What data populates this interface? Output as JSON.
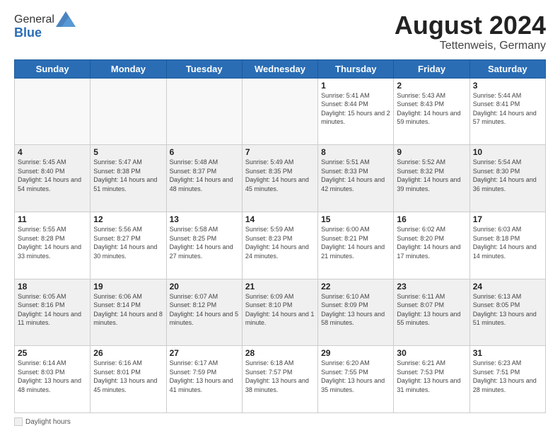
{
  "header": {
    "logo_general": "General",
    "logo_blue": "Blue",
    "month_year": "August 2024",
    "location": "Tettenweis, Germany"
  },
  "footer": {
    "label": "Daylight hours"
  },
  "days_of_week": [
    "Sunday",
    "Monday",
    "Tuesday",
    "Wednesday",
    "Thursday",
    "Friday",
    "Saturday"
  ],
  "weeks": [
    [
      {
        "day": "",
        "info": "",
        "empty": true
      },
      {
        "day": "",
        "info": "",
        "empty": true
      },
      {
        "day": "",
        "info": "",
        "empty": true
      },
      {
        "day": "",
        "info": "",
        "empty": true
      },
      {
        "day": "1",
        "info": "Sunrise: 5:41 AM\nSunset: 8:44 PM\nDaylight: 15 hours\nand 2 minutes.",
        "empty": false
      },
      {
        "day": "2",
        "info": "Sunrise: 5:43 AM\nSunset: 8:43 PM\nDaylight: 14 hours\nand 59 minutes.",
        "empty": false
      },
      {
        "day": "3",
        "info": "Sunrise: 5:44 AM\nSunset: 8:41 PM\nDaylight: 14 hours\nand 57 minutes.",
        "empty": false
      }
    ],
    [
      {
        "day": "4",
        "info": "Sunrise: 5:45 AM\nSunset: 8:40 PM\nDaylight: 14 hours\nand 54 minutes.",
        "shaded": true
      },
      {
        "day": "5",
        "info": "Sunrise: 5:47 AM\nSunset: 8:38 PM\nDaylight: 14 hours\nand 51 minutes.",
        "shaded": true
      },
      {
        "day": "6",
        "info": "Sunrise: 5:48 AM\nSunset: 8:37 PM\nDaylight: 14 hours\nand 48 minutes.",
        "shaded": true
      },
      {
        "day": "7",
        "info": "Sunrise: 5:49 AM\nSunset: 8:35 PM\nDaylight: 14 hours\nand 45 minutes.",
        "shaded": true
      },
      {
        "day": "8",
        "info": "Sunrise: 5:51 AM\nSunset: 8:33 PM\nDaylight: 14 hours\nand 42 minutes.",
        "shaded": true
      },
      {
        "day": "9",
        "info": "Sunrise: 5:52 AM\nSunset: 8:32 PM\nDaylight: 14 hours\nand 39 minutes.",
        "shaded": true
      },
      {
        "day": "10",
        "info": "Sunrise: 5:54 AM\nSunset: 8:30 PM\nDaylight: 14 hours\nand 36 minutes.",
        "shaded": true
      }
    ],
    [
      {
        "day": "11",
        "info": "Sunrise: 5:55 AM\nSunset: 8:28 PM\nDaylight: 14 hours\nand 33 minutes.",
        "empty": false
      },
      {
        "day": "12",
        "info": "Sunrise: 5:56 AM\nSunset: 8:27 PM\nDaylight: 14 hours\nand 30 minutes.",
        "empty": false
      },
      {
        "day": "13",
        "info": "Sunrise: 5:58 AM\nSunset: 8:25 PM\nDaylight: 14 hours\nand 27 minutes.",
        "empty": false
      },
      {
        "day": "14",
        "info": "Sunrise: 5:59 AM\nSunset: 8:23 PM\nDaylight: 14 hours\nand 24 minutes.",
        "empty": false
      },
      {
        "day": "15",
        "info": "Sunrise: 6:00 AM\nSunset: 8:21 PM\nDaylight: 14 hours\nand 21 minutes.",
        "empty": false
      },
      {
        "day": "16",
        "info": "Sunrise: 6:02 AM\nSunset: 8:20 PM\nDaylight: 14 hours\nand 17 minutes.",
        "empty": false
      },
      {
        "day": "17",
        "info": "Sunrise: 6:03 AM\nSunset: 8:18 PM\nDaylight: 14 hours\nand 14 minutes.",
        "empty": false
      }
    ],
    [
      {
        "day": "18",
        "info": "Sunrise: 6:05 AM\nSunset: 8:16 PM\nDaylight: 14 hours\nand 11 minutes.",
        "shaded": true
      },
      {
        "day": "19",
        "info": "Sunrise: 6:06 AM\nSunset: 8:14 PM\nDaylight: 14 hours\nand 8 minutes.",
        "shaded": true
      },
      {
        "day": "20",
        "info": "Sunrise: 6:07 AM\nSunset: 8:12 PM\nDaylight: 14 hours\nand 5 minutes.",
        "shaded": true
      },
      {
        "day": "21",
        "info": "Sunrise: 6:09 AM\nSunset: 8:10 PM\nDaylight: 14 hours\nand 1 minute.",
        "shaded": true
      },
      {
        "day": "22",
        "info": "Sunrise: 6:10 AM\nSunset: 8:09 PM\nDaylight: 13 hours\nand 58 minutes.",
        "shaded": true
      },
      {
        "day": "23",
        "info": "Sunrise: 6:11 AM\nSunset: 8:07 PM\nDaylight: 13 hours\nand 55 minutes.",
        "shaded": true
      },
      {
        "day": "24",
        "info": "Sunrise: 6:13 AM\nSunset: 8:05 PM\nDaylight: 13 hours\nand 51 minutes.",
        "shaded": true
      }
    ],
    [
      {
        "day": "25",
        "info": "Sunrise: 6:14 AM\nSunset: 8:03 PM\nDaylight: 13 hours\nand 48 minutes.",
        "empty": false
      },
      {
        "day": "26",
        "info": "Sunrise: 6:16 AM\nSunset: 8:01 PM\nDaylight: 13 hours\nand 45 minutes.",
        "empty": false
      },
      {
        "day": "27",
        "info": "Sunrise: 6:17 AM\nSunset: 7:59 PM\nDaylight: 13 hours\nand 41 minutes.",
        "empty": false
      },
      {
        "day": "28",
        "info": "Sunrise: 6:18 AM\nSunset: 7:57 PM\nDaylight: 13 hours\nand 38 minutes.",
        "empty": false
      },
      {
        "day": "29",
        "info": "Sunrise: 6:20 AM\nSunset: 7:55 PM\nDaylight: 13 hours\nand 35 minutes.",
        "empty": false
      },
      {
        "day": "30",
        "info": "Sunrise: 6:21 AM\nSunset: 7:53 PM\nDaylight: 13 hours\nand 31 minutes.",
        "empty": false
      },
      {
        "day": "31",
        "info": "Sunrise: 6:23 AM\nSunset: 7:51 PM\nDaylight: 13 hours\nand 28 minutes.",
        "empty": false
      }
    ]
  ]
}
